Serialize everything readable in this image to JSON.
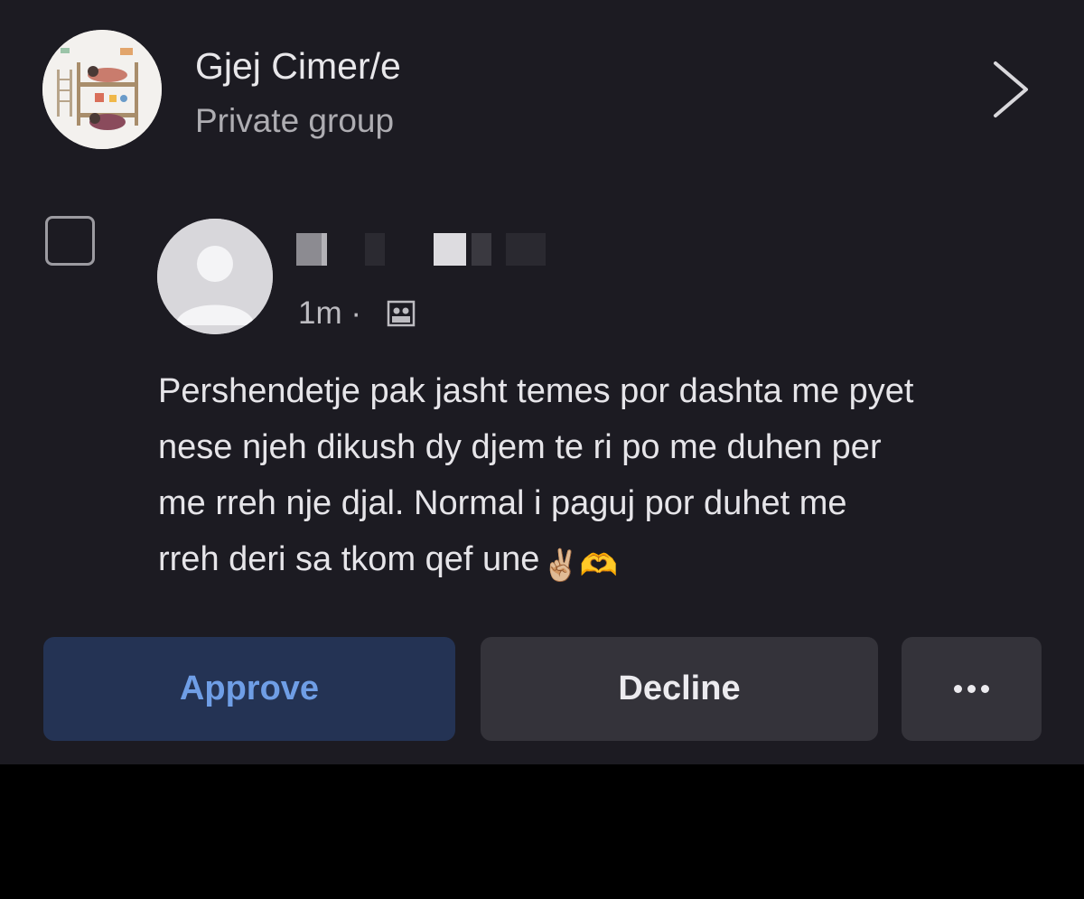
{
  "group": {
    "name": "Gjej Cimer/e",
    "privacy": "Private group",
    "avatar_icon": "bunk-bed-illustration-icon",
    "open_icon": "chevron-right-icon"
  },
  "post": {
    "select_icon": "checkbox-icon",
    "author_avatar_icon": "default-profile-icon",
    "time": "1m ·",
    "audience_icon": "group-members-icon",
    "lines": [
      "Pershendetje pak jasht temes por dashta me pyet",
      "nese njeh dikush dy djem te ri po me duhen per",
      "me rreh nje djal. Normal i paguj por duhet me",
      "rreh deri sa tkom qef une"
    ],
    "emojis": "✌🏼🫶"
  },
  "actions": {
    "approve_label": "Approve",
    "decline_label": "Decline",
    "more_icon": "more-options-icon"
  },
  "colors": {
    "background": "#1c1b22",
    "approve_bg": "#243354",
    "approve_text": "#6f9ee6",
    "button_bg": "#34333a"
  }
}
